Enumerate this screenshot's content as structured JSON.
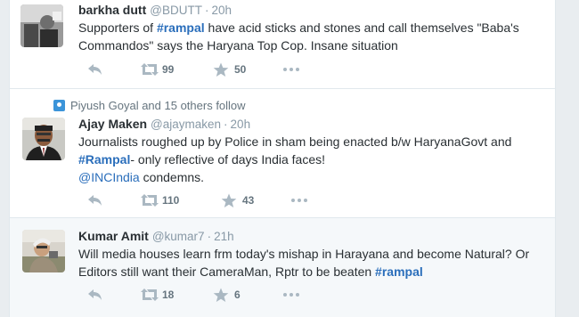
{
  "colors": {
    "link": "#2a6ebb",
    "muted": "#8899a6",
    "action": "#aab8c2"
  },
  "tweets": [
    {
      "fullname": "barkha dutt",
      "handle": "@BDUTT",
      "time": "20h",
      "text_parts": [
        {
          "t": "Supporters of ",
          "k": "plain"
        },
        {
          "t": "#rampal",
          "k": "hashtag"
        },
        {
          "t": " have acid sticks and stones and call themselves \"Baba's Commandos\" says the Haryana Top Cop. Insane situation",
          "k": "plain"
        }
      ],
      "retweets": "99",
      "favorites": "50"
    },
    {
      "context": "Piyush Goyal and 15 others follow",
      "fullname": "Ajay Maken",
      "handle": "@ajaymaken",
      "time": "20h",
      "text_parts": [
        {
          "t": "Journalists roughed up by Police in sham being enacted b/w HaryanaGovt and ",
          "k": "plain"
        },
        {
          "t": "#Rampal",
          "k": "hashtag"
        },
        {
          "t": "- only reflective of days India faces!",
          "k": "plain"
        },
        {
          "t": "\n",
          "k": "br"
        },
        {
          "t": "@INCIndia",
          "k": "mention"
        },
        {
          "t": " condemns.",
          "k": "plain"
        }
      ],
      "retweets": "110",
      "favorites": "43"
    },
    {
      "fullname": "Kumar Amit",
      "handle": "@kumar7",
      "time": "21h",
      "text_parts": [
        {
          "t": "Will media houses learn frm today's mishap in Harayana and become Natural? Or Editors still want their CameraMan, Rptr to be beaten ",
          "k": "plain"
        },
        {
          "t": "#rampal",
          "k": "hashtag"
        }
      ],
      "retweets": "18",
      "favorites": "6"
    }
  ]
}
